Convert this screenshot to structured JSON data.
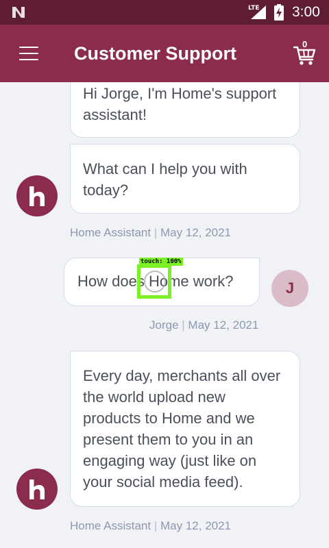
{
  "status_bar": {
    "network": "LTE",
    "time": "3:00"
  },
  "app_bar": {
    "title": "Customer Support",
    "cart_count": "0"
  },
  "messages": [
    {
      "sender": "bot",
      "text": "Hi Jorge, I'm Home's support assistant!"
    },
    {
      "sender": "bot",
      "text": "What can I help you with today?",
      "meta_name": "Home Assistant",
      "meta_separator": "|",
      "meta_date": "May 12, 2021"
    },
    {
      "sender": "user",
      "text": "How does Home work?",
      "avatar_initial": "J",
      "meta_name": "Jorge",
      "meta_separator": "|",
      "meta_date": "May 12, 2021"
    },
    {
      "sender": "bot",
      "text": "Every day, merchants all over the world upload new products to Home and we present them to you in an engaging way (just like on your social media feed).",
      "meta_name": "Home Assistant",
      "meta_separator": "|",
      "meta_date": "May 12, 2021"
    }
  ],
  "touch_indicator": {
    "label": "touch: 100%"
  },
  "colors": {
    "status_bar": "#5e1c35",
    "app_bar": "#8b2c4f",
    "bot_avatar": "#8b2c4f",
    "user_avatar": "#d9bcc7",
    "background": "#f1f2f6",
    "touch_marker": "#7cf026"
  },
  "icons": {
    "status": [
      "n-logo-icon",
      "signal-icon",
      "battery-charging-icon"
    ],
    "app_bar": [
      "menu-icon",
      "cart-icon"
    ],
    "bot_avatar": "home-h-logo-icon"
  }
}
